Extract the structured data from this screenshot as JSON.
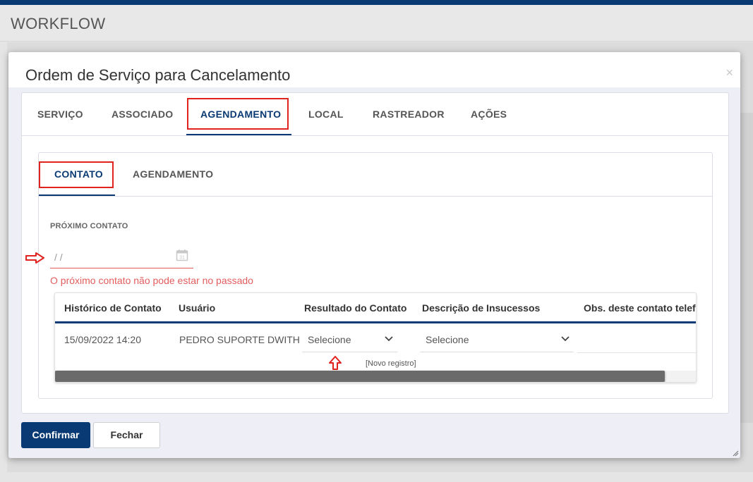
{
  "app": {
    "title": "WORKFLOW"
  },
  "modal": {
    "title": "Ordem de Serviço para Cancelamento",
    "close_symbol": "×",
    "tabs": [
      {
        "label": "SERVIÇO",
        "active": false
      },
      {
        "label": "ASSOCIADO",
        "active": false
      },
      {
        "label": "AGENDAMENTO",
        "active": true
      },
      {
        "label": "LOCAL",
        "active": false
      },
      {
        "label": "RASTREADOR",
        "active": false
      },
      {
        "label": "AÇÕES",
        "active": false
      }
    ],
    "subtabs": [
      {
        "label": "CONTATO",
        "active": true
      },
      {
        "label": "AGENDAMENTO",
        "active": false
      }
    ],
    "next_contact": {
      "label": "PRÓXIMO CONTATO",
      "value": "/ /",
      "error": "O próximo contato não pode estar no passado",
      "icon": "calendar-icon"
    },
    "history_table": {
      "columns": [
        "Histórico de Contato",
        "Usuário",
        "Resultado do Contato",
        "Descrição de Insucessos",
        "Obs. deste contato telef"
      ],
      "rows": [
        {
          "date": "15/09/2022 14:20",
          "user": "PEDRO SUPORTE DWITH",
          "result": "Selecione",
          "failure_desc": "Selecione",
          "obs": ""
        }
      ],
      "new_record_label": "[Novo registro]"
    },
    "buttons": {
      "confirm": "Confirmar",
      "close": "Fechar"
    }
  },
  "colors": {
    "primary": "#0a3a73",
    "highlight_red": "#e0231f",
    "error": "#e35d5d"
  }
}
